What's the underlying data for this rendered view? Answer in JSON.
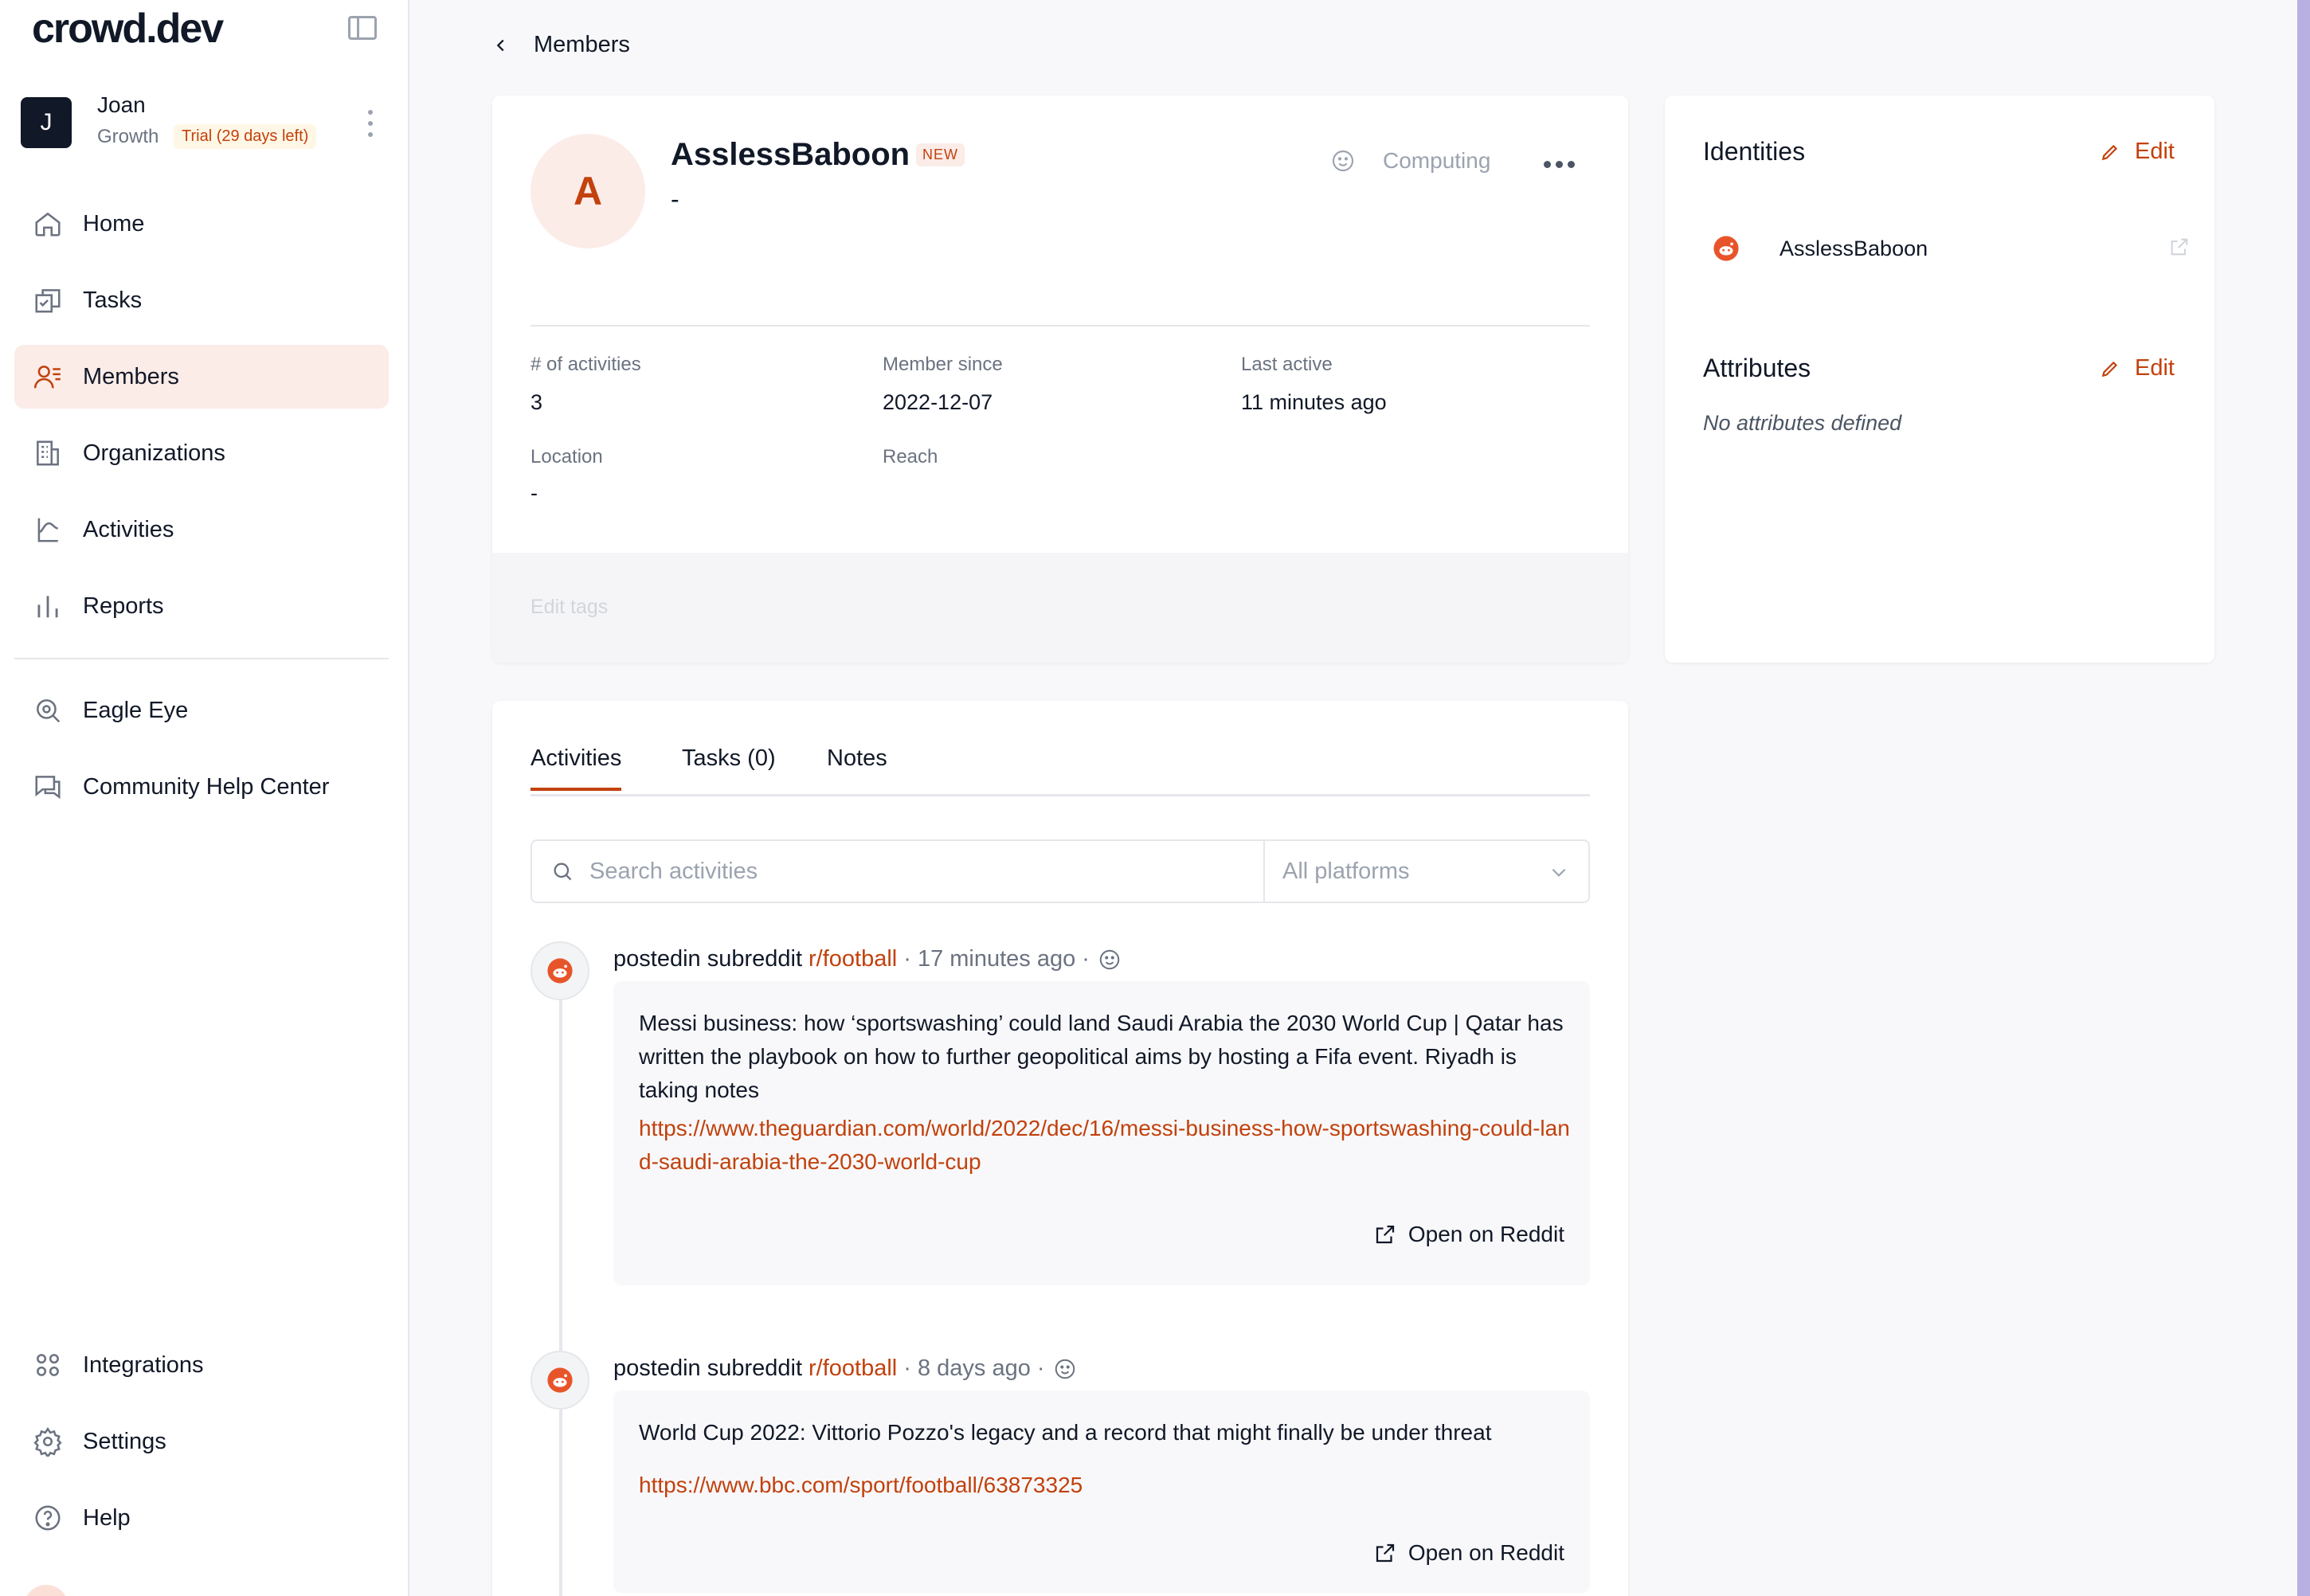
{
  "app": {
    "logo": "crowd.dev"
  },
  "user": {
    "initial": "J",
    "name": "Joan",
    "plan": "Growth",
    "trial": "Trial (29 days left)"
  },
  "nav": {
    "home": "Home",
    "tasks": "Tasks",
    "members": "Members",
    "organizations": "Organizations",
    "activities": "Activities",
    "reports": "Reports",
    "eagle_eye": "Eagle Eye",
    "help_center": "Community Help Center",
    "integrations": "Integrations",
    "settings": "Settings",
    "help": "Help"
  },
  "breadcrumb": {
    "label": "Members"
  },
  "member": {
    "initial": "A",
    "name": "AsslessBaboon",
    "badge": "NEW",
    "subtitle": "-",
    "engagement": "Computing",
    "stats": {
      "activities_label": "# of activities",
      "activities_value": "3",
      "since_label": "Member since",
      "since_value": "2022-12-07",
      "last_active_label": "Last active",
      "last_active_value": "11 minutes ago",
      "location_label": "Location",
      "location_value": "-",
      "reach_label": "Reach"
    },
    "edit_tags": "Edit tags"
  },
  "identities": {
    "title": "Identities",
    "edit": "Edit",
    "items": [
      {
        "platform": "reddit",
        "handle": "AsslessBaboon"
      }
    ]
  },
  "attributes": {
    "title": "Attributes",
    "edit": "Edit",
    "empty": "No attributes defined"
  },
  "tabs": {
    "activities": "Activities",
    "tasks": "Tasks (0)",
    "notes": "Notes"
  },
  "search": {
    "placeholder": "Search activities",
    "platform_placeholder": "All platforms"
  },
  "activities": [
    {
      "action": "postedin subreddit",
      "subreddit": "r/football",
      "time": "· 17 minutes ago ·",
      "title": "Messi business: how ‘sportswashing’ could land Saudi Arabia the 2030 World Cup | Qatar has written the playbook on how to further geopolitical aims by hosting a Fifa event. Riyadh is taking notes",
      "link": "https://www.theguardian.com/world/2022/dec/16/messi-business-how-sportswashing-could-land-saudi-arabia-the-2030-world-cup",
      "open_label": "Open on Reddit"
    },
    {
      "action": "postedin subreddit",
      "subreddit": "r/football",
      "time": "· 8 days ago ·",
      "title": "World Cup 2022: Vittorio Pozzo's legacy and a record that might finally be under threat",
      "link": "https://www.bbc.com/sport/football/63873325",
      "open_label": "Open on Reddit"
    }
  ],
  "colors": {
    "accent": "#c2410c",
    "active_bg": "#fbece8",
    "reddit": "#e8542a"
  }
}
